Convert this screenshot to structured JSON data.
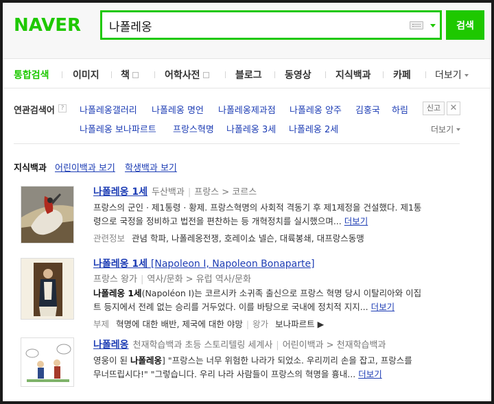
{
  "header": {
    "logo": "NAVER",
    "query": "나폴레옹",
    "search_button": "검색"
  },
  "tabs": [
    {
      "label": "통합검색"
    },
    {
      "label": "이미지"
    },
    {
      "label": "책"
    },
    {
      "label": "어학사전"
    },
    {
      "label": "블로그"
    },
    {
      "label": "동영상"
    },
    {
      "label": "지식백과"
    },
    {
      "label": "카페"
    },
    {
      "label": "더보기"
    }
  ],
  "related": {
    "label": "연관검색어",
    "help": "?",
    "row1": [
      "나폴레옹갤러리",
      "나폴레옹 명언",
      "나폴레옹제과점",
      "나폴레옹 양주",
      "김홍국",
      "하림"
    ],
    "row2": [
      "나폴레옹 보나파르트",
      "프랑스혁명",
      "나폴레옹 3세",
      "나폴레옹 2세"
    ],
    "report": "신고",
    "close": "✕",
    "more": "더보기"
  },
  "knowledge": {
    "title": "지식백과",
    "links": [
      "어린이백과 보기",
      "학생백과 보기"
    ]
  },
  "results": [
    {
      "title": "나폴레옹 1세",
      "source": "두산백과",
      "path": "프랑스 > 코르스",
      "desc1": "프랑스의 군인 · 제1통령 · 황제. 프랑스혁명의 사회적 격동기 후 제1제정을 건설했다. 제1통",
      "desc2": "령으로 국정을 정비하고 법전을 편찬하는 등 개혁정치를 실시했으며...",
      "more": "더보기",
      "extra_label": "관련정보",
      "extra": "관념 학파, 나폴레옹전쟁, 호레이쇼 넬슨, 대륙봉쇄, 대프랑스동맹"
    },
    {
      "title": "나폴레옹 1세",
      "title_suffix": "[Napoleon I, Napoleon Bonaparte]",
      "source": "프랑스 왕가",
      "path": "역사/문화 > 유럽 역사/문화",
      "desc_bold": "나폴레옹 1세",
      "desc1": "(Napoléon I)는 코르시카 소귀족 출신으로 프랑스 혁명 당시 이탈리아와 이집",
      "desc2": "트 등지에서 전례 없는 승리를 거두었다. 이를 바탕으로 국내에 정치적 지지...",
      "more": "더보기",
      "extra_label": "부제",
      "extra": "혁명에 대한 배반, 제국에 대한 야망",
      "extra_sep": "|",
      "extra_label2": "왕가",
      "extra2": "보나파르트 ▶"
    },
    {
      "title": "나폴레옹",
      "source": "천재학습백과 초등 스토리텔링 세계사",
      "path": "어린이백과 > 천재학습백과",
      "desc_pre": "영웅이 된 ",
      "desc_bold": "나폴레옹",
      "desc1": "] \"프랑스는 너무 위험한 나라가 되었소. 우리끼리 손을 잡고, 프랑스를",
      "desc2": "무너뜨립시다!\" \"그렇습니다. 우리 나라 사람들이 프랑스의 혁명을 흉내...",
      "more": "더보기"
    }
  ],
  "colors": {
    "brand": "#1ec800",
    "link": "#1c3cb4"
  }
}
